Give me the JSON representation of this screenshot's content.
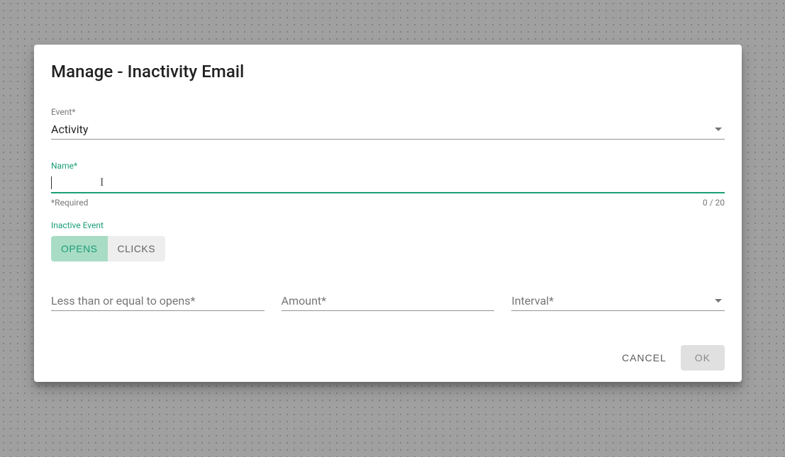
{
  "dialog": {
    "title": "Manage - Inactivity Email"
  },
  "event_field": {
    "label": "Event*",
    "value": "Activity"
  },
  "name_field": {
    "label": "Name*",
    "value": "",
    "required_hint": "*Required",
    "counter": "0 / 20"
  },
  "inactive_event": {
    "label": "Inactive Event",
    "options": {
      "opens": "OPENS",
      "clicks": "CLICKS"
    },
    "selected": "opens"
  },
  "opens_field": {
    "placeholder": "Less than or equal to opens*"
  },
  "amount_field": {
    "placeholder": "Amount*"
  },
  "interval_field": {
    "placeholder": "Interval*"
  },
  "actions": {
    "cancel": "CANCEL",
    "ok": "OK"
  }
}
